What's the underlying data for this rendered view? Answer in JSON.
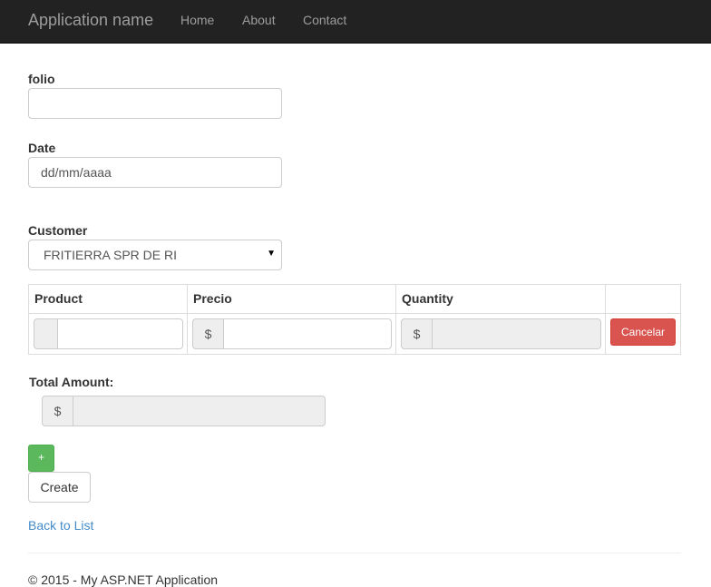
{
  "navbar": {
    "brand": "Application name",
    "links": [
      "Home",
      "About",
      "Contact"
    ]
  },
  "form": {
    "folio": {
      "label": "folio",
      "value": ""
    },
    "date": {
      "label": "Date",
      "value": "dd/mm/aaaa"
    },
    "customer": {
      "label": "Customer",
      "selected": "FRITIERRA SPR DE RI"
    }
  },
  "table": {
    "headers": [
      "Product",
      "Precio",
      "Quantity",
      ""
    ],
    "row": {
      "precio_addon": "$",
      "quantity_addon": "$",
      "cancel_label": "Cancelar"
    }
  },
  "total": {
    "label": "Total Amount:",
    "addon": "$"
  },
  "buttons": {
    "add_label": "+",
    "create_label": "Create"
  },
  "back_link": "Back to List",
  "footer": "© 2015 - My ASP.NET Application",
  "colors": {
    "navbar_bg": "#222222",
    "danger": "#d9534f",
    "success": "#5cb85c",
    "link": "#428bca"
  }
}
